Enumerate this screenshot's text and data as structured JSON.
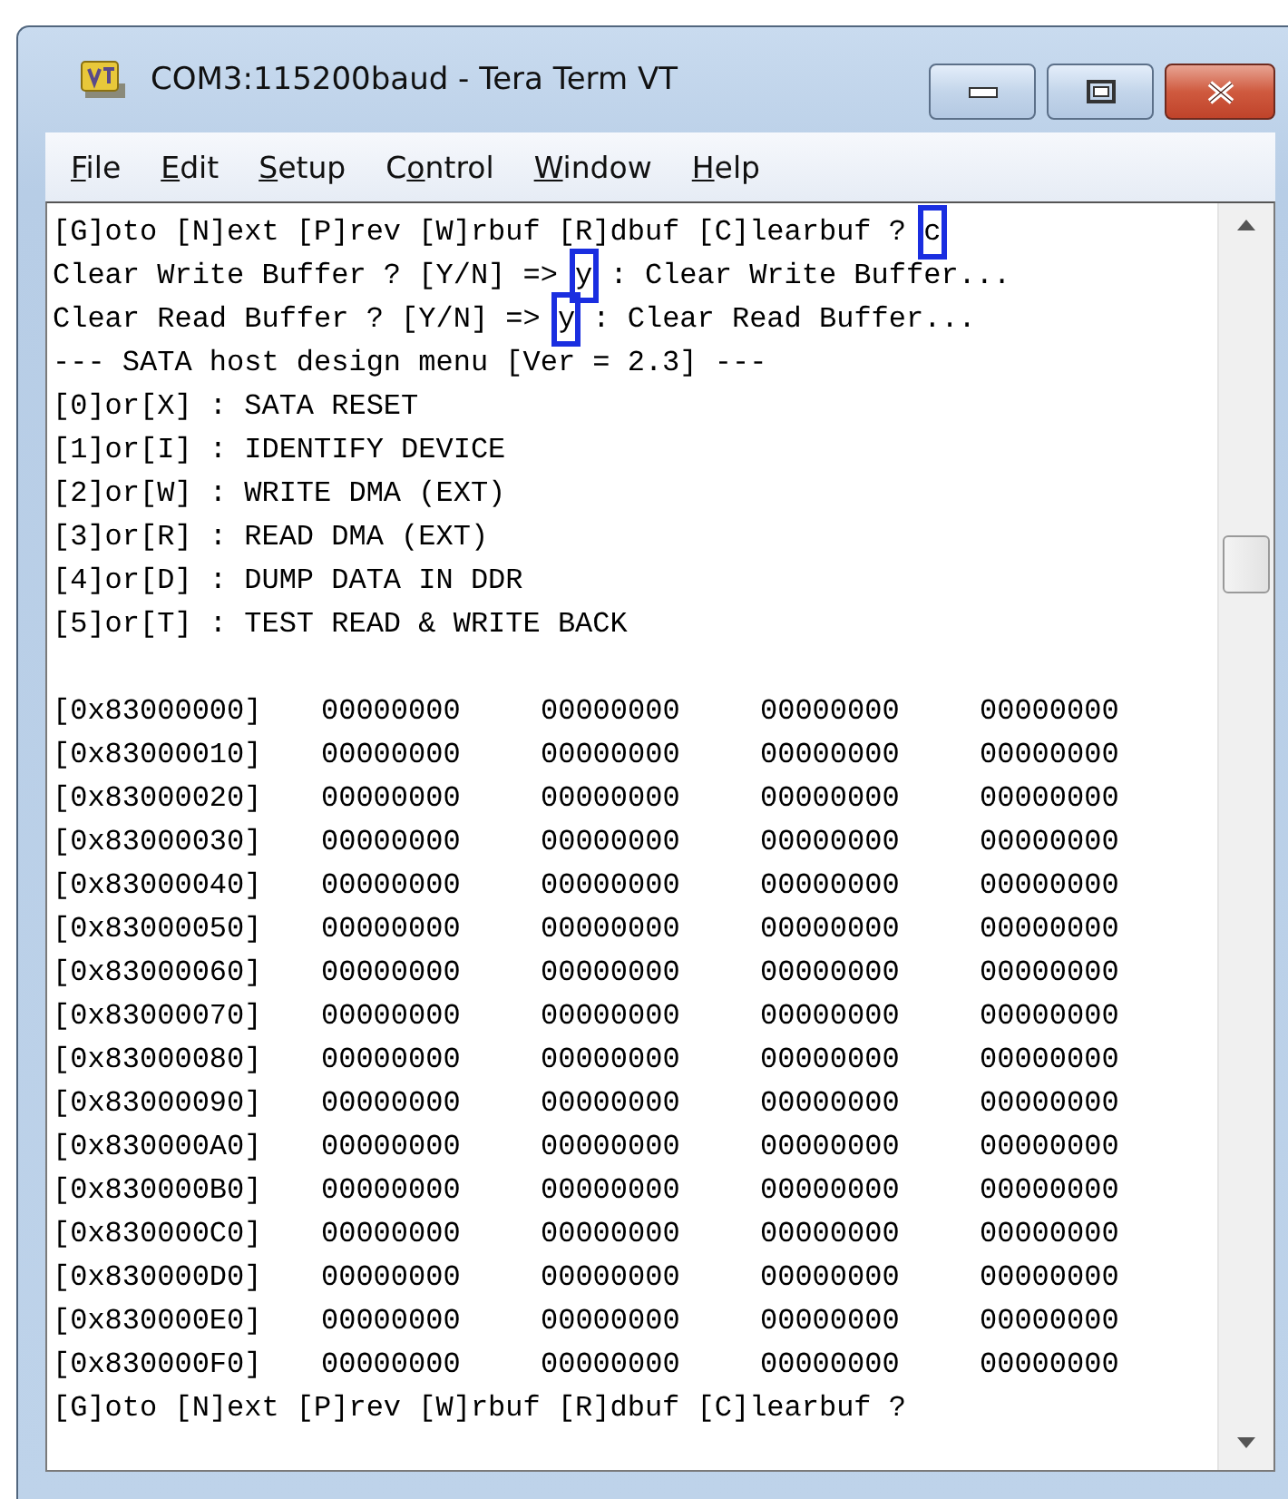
{
  "window": {
    "title": "COM3:115200baud - Tera Term VT"
  },
  "menu": [
    {
      "access_key": "F",
      "label_after": "ile"
    },
    {
      "access_key": "E",
      "label_after": "dit"
    },
    {
      "access_key": "S",
      "label_after": "etup"
    },
    {
      "label_before": "C",
      "access_key": "o",
      "label_after": "ntrol"
    },
    {
      "access_key": "W",
      "label_after": "indow"
    },
    {
      "access_key": "H",
      "label_after": "elp"
    }
  ],
  "console_lines": [
    {
      "text": "[G]oto [N]ext [P]rev [W]rbuf [R]dbuf [C]learbuf ? ",
      "typed": "c",
      "typed_boxed": true
    },
    {
      "text": "Clear Write Buffer ? [Y/N] => ",
      "typed": "y",
      "typed_boxed": true,
      "response": " : Clear Write Buffer..."
    },
    {
      "text": "Clear Read Buffer ? [Y/N] => ",
      "typed": "y",
      "typed_boxed": true,
      "response": " : Clear Read Buffer..."
    },
    {
      "text": "--- SATA host design menu [Ver = 2.3] ---"
    },
    {
      "text": "[0]or[X] : SATA RESET"
    },
    {
      "text": "[1]or[I] : IDENTIFY DEVICE"
    },
    {
      "text": "[2]or[W] : WRITE DMA (EXT)"
    },
    {
      "text": "[3]or[R] : READ DMA (EXT)"
    },
    {
      "text": "[4]or[D] : DUMP DATA IN DDR"
    },
    {
      "text": "[5]or[T] : TEST READ & WRITE BACK"
    }
  ],
  "memory_dump": {
    "rows": [
      {
        "address": "[0x83000000]",
        "words": [
          "00000000",
          "00000000",
          "00000000",
          "00000000"
        ]
      },
      {
        "address": "[0x83000010]",
        "words": [
          "00000000",
          "00000000",
          "00000000",
          "00000000"
        ]
      },
      {
        "address": "[0x83000020]",
        "words": [
          "00000000",
          "00000000",
          "00000000",
          "00000000"
        ]
      },
      {
        "address": "[0x83000030]",
        "words": [
          "00000000",
          "00000000",
          "00000000",
          "00000000"
        ]
      },
      {
        "address": "[0x83000040]",
        "words": [
          "00000000",
          "00000000",
          "00000000",
          "00000000"
        ]
      },
      {
        "address": "[0x83000050]",
        "words": [
          "00000000",
          "00000000",
          "00000000",
          "00000000"
        ]
      },
      {
        "address": "[0x83000060]",
        "words": [
          "00000000",
          "00000000",
          "00000000",
          "00000000"
        ]
      },
      {
        "address": "[0x83000070]",
        "words": [
          "00000000",
          "00000000",
          "00000000",
          "00000000"
        ]
      },
      {
        "address": "[0x83000080]",
        "words": [
          "00000000",
          "00000000",
          "00000000",
          "00000000"
        ]
      },
      {
        "address": "[0x83000090]",
        "words": [
          "00000000",
          "00000000",
          "00000000",
          "00000000"
        ]
      },
      {
        "address": "[0x830000A0]",
        "words": [
          "00000000",
          "00000000",
          "00000000",
          "00000000"
        ]
      },
      {
        "address": "[0x830000B0]",
        "words": [
          "00000000",
          "00000000",
          "00000000",
          "00000000"
        ]
      },
      {
        "address": "[0x830000C0]",
        "words": [
          "00000000",
          "00000000",
          "00000000",
          "00000000"
        ]
      },
      {
        "address": "[0x830000D0]",
        "words": [
          "00000000",
          "00000000",
          "00000000",
          "00000000"
        ]
      },
      {
        "address": "[0x830000E0]",
        "words": [
          "00000000",
          "00000000",
          "00000000",
          "00000000"
        ]
      },
      {
        "address": "[0x830000F0]",
        "words": [
          "00000000",
          "00000000",
          "00000000",
          "00000000"
        ]
      }
    ]
  },
  "final_prompt": "[G]oto [N]ext [P]rev [W]rbuf [R]dbuf [C]learbuf ?"
}
